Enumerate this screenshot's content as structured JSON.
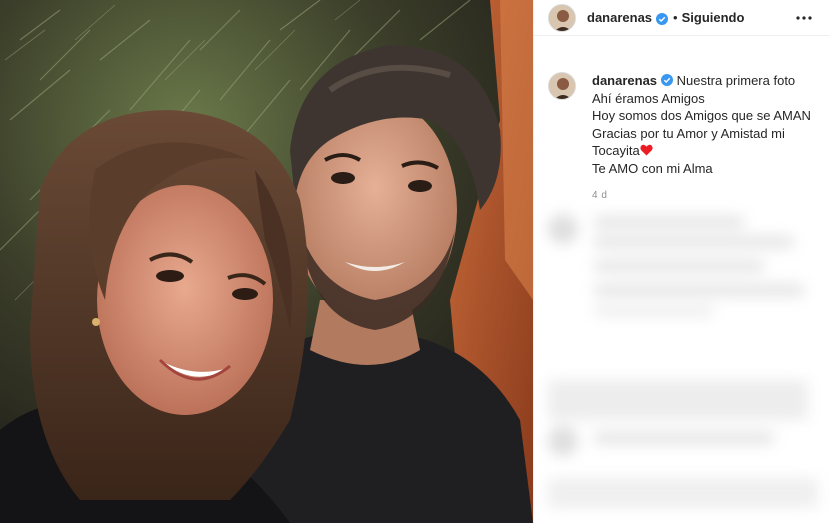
{
  "header": {
    "username": "danarenas",
    "separator": "•",
    "follow_status": "Siguiendo"
  },
  "caption": {
    "username": "danarenas",
    "lines": [
      "Nuestra primera foto",
      "Ahí éramos Amigos",
      "Hoy somos dos Amigos que se AMAN",
      "Gracias por tu Amor y Amistad mi",
      "Tocayita",
      "Te AMO con mi Alma"
    ],
    "heart_emoji": "❤️",
    "timestamp": "4 d"
  },
  "colors": {
    "verified": "#3897f0",
    "text": "#262626",
    "muted": "#8e8e8e",
    "heart": "#ed1c24"
  },
  "icons": {
    "verified": "verified-badge-icon",
    "more": "more-options-icon"
  }
}
